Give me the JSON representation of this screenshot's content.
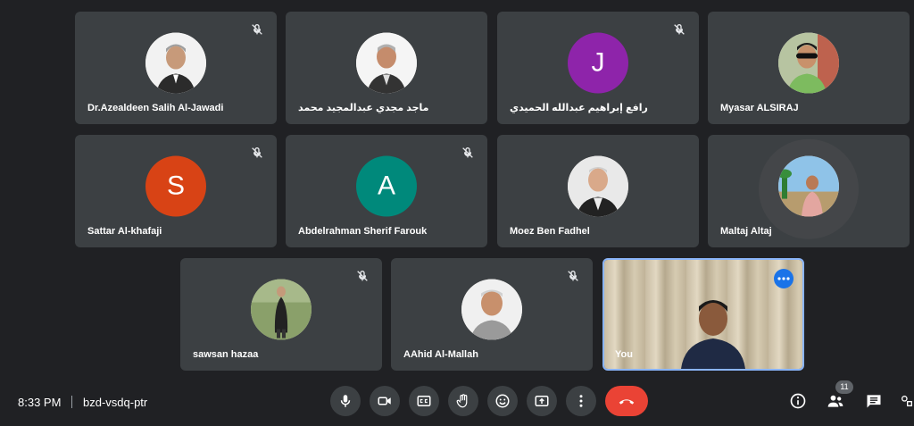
{
  "participants": [
    {
      "name": "Dr.Azealdeen Salih Al-Jawadi",
      "avatar": "photo",
      "muted": true
    },
    {
      "name": "ماجد مجدي عبدالمجيد محمد",
      "avatar": "photo",
      "muted": false
    },
    {
      "name": "رافع إبراهيم عبدالله الحميدي",
      "avatar": "initial",
      "initial": "J",
      "color": "#8e24aa",
      "muted": true
    },
    {
      "name": "Myasar ALSIRAJ",
      "avatar": "photo",
      "muted": false
    },
    {
      "name": "Sattar Al-khafaji",
      "avatar": "initial",
      "initial": "S",
      "color": "#d84315",
      "muted": true
    },
    {
      "name": "Abdelrahman Sherif Farouk",
      "avatar": "initial",
      "initial": "A",
      "color": "#00897b",
      "muted": true
    },
    {
      "name": "Moez Ben Fadhel",
      "avatar": "photo",
      "muted": false
    },
    {
      "name": "Maltaj Altaj",
      "avatar": "photo",
      "muted": false
    },
    {
      "name": "sawsan hazaa",
      "avatar": "photo",
      "muted": true
    },
    {
      "name": "AAhid Al-Mallah",
      "avatar": "photo",
      "muted": true
    }
  ],
  "self_view": {
    "name": "You"
  },
  "bottom_bar": {
    "time": "8:33 PM",
    "meeting_code": "bzd-vsdq-ptr",
    "participant_count": "11"
  },
  "colors": {
    "background": "#202124",
    "tile": "#3c4043",
    "hangup": "#ea4335",
    "self_border": "#8ab4f8",
    "more_button": "#1a73e8"
  }
}
